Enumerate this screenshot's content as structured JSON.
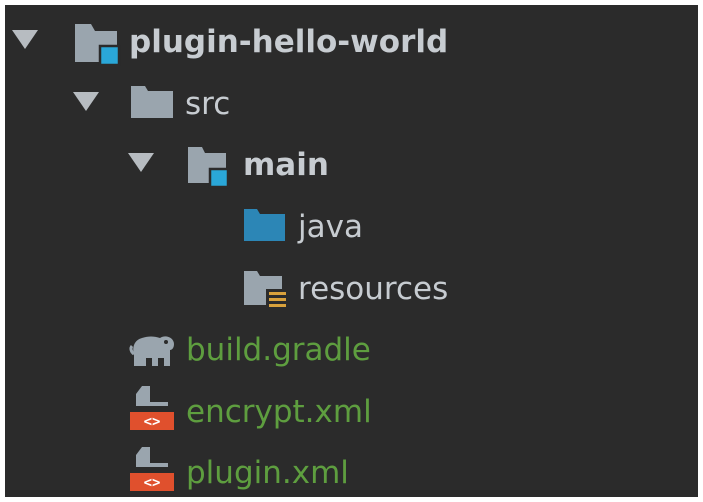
{
  "colors": {
    "background": "#2b2b2b",
    "text_default": "#c7ccd1",
    "text_gradle": "#5e9e3f",
    "folder_gray": "#9aa5ae",
    "folder_blue": "#2aa7d8",
    "java_folder": "#2c86b6",
    "resources_lines": "#d8a13c",
    "xml_badge": "#e0502d"
  },
  "tree": {
    "project": {
      "label": "plugin-hello-world",
      "icon": "module-folder-icon",
      "expanded": true
    },
    "src": {
      "label": "src",
      "icon": "folder-icon",
      "expanded": true
    },
    "main": {
      "label": "main",
      "icon": "source-folder-icon",
      "expanded": true
    },
    "java": {
      "label": "java",
      "icon": "java-source-root-icon"
    },
    "resources": {
      "label": "resources",
      "icon": "resources-root-icon"
    },
    "build_gradle": {
      "label": "build.gradle",
      "icon": "gradle-elephant-icon"
    },
    "encrypt_xml": {
      "label": "encrypt.xml",
      "icon": "xml-file-icon"
    },
    "plugin_xml": {
      "label": "plugin.xml",
      "icon": "xml-file-icon"
    }
  }
}
